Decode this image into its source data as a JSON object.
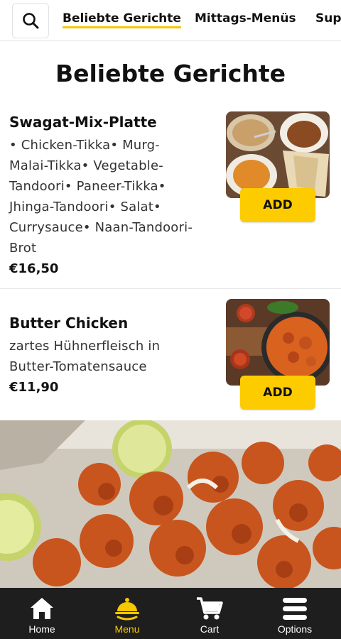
{
  "header": {
    "search_icon": "search-icon",
    "tabs": [
      {
        "label": "Beliebte Gerichte",
        "active": true
      },
      {
        "label": "Mittags-Menüs",
        "active": false
      },
      {
        "label": "Suppen",
        "active": false
      }
    ]
  },
  "section": {
    "title": "Beliebte Gerichte"
  },
  "dishes": [
    {
      "name": "Swagat-Mix-Platte",
      "description_lines": [
        "• Chicken-Tikka• Murg-",
        "Malai-Tikka• Vegetable-",
        "Tandoori• Paneer-Tikka•",
        "Jhinga-Tandoori• Salat•",
        "Currysauce• Naan-Tandoori-",
        "Brot"
      ],
      "price": "€16,50",
      "add_label": "ADD"
    },
    {
      "name": "Butter Chicken",
      "description_lines": [
        "zartes Hühnerfleisch in",
        "Butter-Tomatensauce"
      ],
      "price": "€11,90",
      "add_label": "ADD"
    }
  ],
  "bottom_nav": [
    {
      "label": "Home",
      "icon": "home-icon",
      "active": false
    },
    {
      "label": "Menu",
      "icon": "menu-cloche-icon",
      "active": true
    },
    {
      "label": "Cart",
      "icon": "cart-icon",
      "active": false
    },
    {
      "label": "Options",
      "icon": "hamburger-icon",
      "active": false
    }
  ],
  "colors": {
    "accent": "#fccc00",
    "nav_bg": "#1e1e1e",
    "active_label": "#f5c800"
  }
}
